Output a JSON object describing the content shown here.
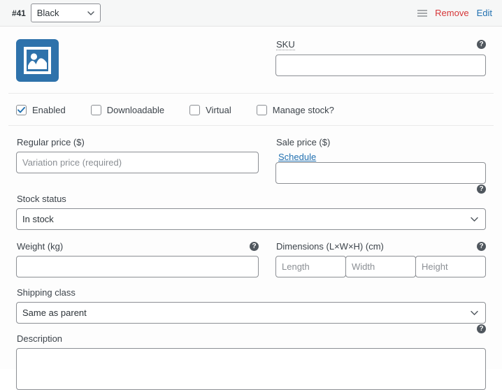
{
  "header": {
    "variation_number": "#41",
    "attribute_value": "Black",
    "attribute_options": [
      "Black"
    ],
    "drag_handle_icon": "hamburger-handle-icon",
    "remove_label": "Remove",
    "edit_label": "Edit",
    "remove_color": "#d63638",
    "edit_color": "#2271b1"
  },
  "thumbnail": {
    "icon": "image-placeholder-icon",
    "color": "#2e72ab"
  },
  "sku": {
    "label": "SKU",
    "value": "",
    "placeholder": "",
    "help_icon": "help-question-icon"
  },
  "checkboxes": [
    {
      "label": "Enabled",
      "checked": true
    },
    {
      "label": "Downloadable",
      "checked": false
    },
    {
      "label": "Virtual",
      "checked": false
    },
    {
      "label": "Manage stock?",
      "checked": false
    }
  ],
  "regular_price": {
    "label": "Regular price ($)",
    "value": "",
    "placeholder": "Variation price (required)"
  },
  "sale_price": {
    "label": "Sale price ($)",
    "schedule_link": "Schedule",
    "value": "",
    "placeholder": ""
  },
  "stock_status": {
    "label": "Stock status",
    "value": "In stock",
    "options": [
      "In stock"
    ],
    "help_icon": "help-question-icon"
  },
  "weight": {
    "label": "Weight (kg)",
    "value": "",
    "placeholder": "",
    "help_icon": "help-question-icon"
  },
  "dimensions": {
    "label": "Dimensions (L×W×H) (cm)",
    "help_icon": "help-question-icon",
    "fields": [
      {
        "name": "length",
        "placeholder": "Length",
        "value": ""
      },
      {
        "name": "width",
        "placeholder": "Width",
        "value": ""
      },
      {
        "name": "height",
        "placeholder": "Height",
        "value": ""
      }
    ]
  },
  "shipping_class": {
    "label": "Shipping class",
    "value": "Same as parent",
    "options": [
      "Same as parent"
    ]
  },
  "description": {
    "label": "Description",
    "value": "",
    "placeholder": "",
    "help_icon": "help-question-icon"
  },
  "colors": {
    "panel_bg": "#fdfdfd",
    "header_bg": "#f6f7f7",
    "border": "#8c8f94",
    "divider": "#eaeaea",
    "text": "#3c434a"
  }
}
